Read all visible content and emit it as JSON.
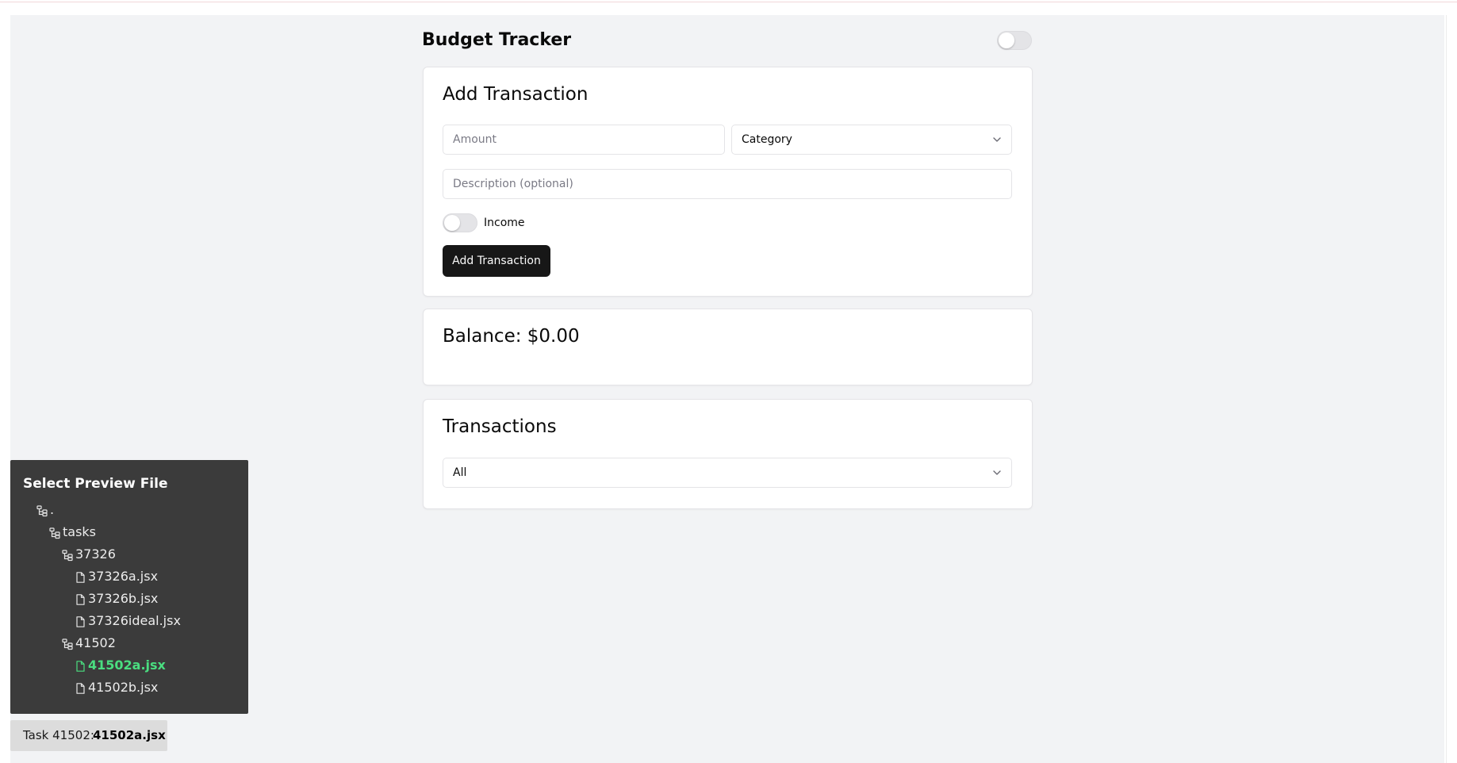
{
  "app": {
    "title": "Budget Tracker"
  },
  "add_transaction": {
    "heading": "Add Transaction",
    "amount_placeholder": "Amount",
    "category_placeholder": "Category",
    "description_placeholder": "Description (optional)",
    "income_label": "Income",
    "income_enabled": false,
    "submit_label": "Add Transaction"
  },
  "balance": {
    "label": "Balance: $0.00"
  },
  "transactions": {
    "heading": "Transactions",
    "filter_value": "All"
  },
  "preview": {
    "title": "Select Preview File",
    "tree": [
      {
        "label": ".",
        "kind": "folder"
      },
      {
        "label": "tasks",
        "kind": "folder"
      },
      {
        "label": "37326",
        "kind": "folder"
      },
      {
        "label": "37326a.jsx",
        "kind": "file"
      },
      {
        "label": "37326b.jsx",
        "kind": "file"
      },
      {
        "label": "37326ideal.jsx",
        "kind": "file"
      },
      {
        "label": "41502",
        "kind": "folder"
      },
      {
        "label": "41502a.jsx",
        "kind": "file",
        "active": true
      },
      {
        "label": "41502b.jsx",
        "kind": "file"
      }
    ]
  },
  "task_badge": {
    "prefix": "Task 41502:",
    "file": "41502a.jsx"
  },
  "colors": {
    "page_background": "#f2f3f5",
    "card_background": "#ffffff",
    "primary_button": "#171717",
    "panel_background": "#3b3b3b",
    "active_file": "#4ade80"
  }
}
